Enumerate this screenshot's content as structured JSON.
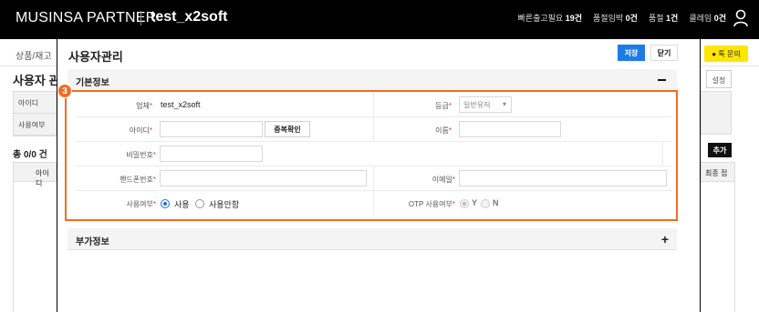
{
  "topbar": {
    "brand": "MUSINSA PARTNER",
    "store": "test_x2soft",
    "stats": [
      {
        "label": "빠른출고필요",
        "value": "19건"
      },
      {
        "label": "품절임박",
        "value": "0건"
      },
      {
        "label": "품절",
        "value": "1건"
      },
      {
        "label": "클레임",
        "value": "0건"
      }
    ],
    "user_icon": "person-icon"
  },
  "background": {
    "tab": "상품/재고",
    "page_title": "사용자 관",
    "filter_labels": [
      "아이디",
      "사용여부"
    ],
    "count": "총 0/0 건",
    "table_header": "아이디",
    "chat_button": "톡 문의",
    "settings_button": "설정",
    "add_button": "추가",
    "last_col_header": "최종 접"
  },
  "modal": {
    "title": "사용자관리",
    "save_label": "저장",
    "close_label": "닫기",
    "basic_section": "기본정보",
    "extra_section": "부가정보",
    "annotation_number": "3",
    "fields": {
      "company_label": "업체",
      "company_value": "test_x2soft",
      "grade_label": "등급",
      "grade_value": "일반유저",
      "id_label": "아이디",
      "id_value": "",
      "dup_check": "중복확인",
      "name_label": "이름",
      "name_value": "",
      "password_label": "비밀번호",
      "phone_label": "핸드폰번호",
      "email_label": "이메일",
      "use_label": "사용여부",
      "use_options": [
        "사용",
        "사용안함"
      ],
      "use_selected": "사용",
      "otp_label": "OTP 사용여부",
      "otp_options": [
        "Y",
        "N"
      ],
      "otp_selected": "Y"
    },
    "required_mark": "*"
  },
  "colors": {
    "accent": "#1e7be6",
    "highlight": "#f26b21",
    "required": "#e53935",
    "chat": "#ffe600"
  }
}
